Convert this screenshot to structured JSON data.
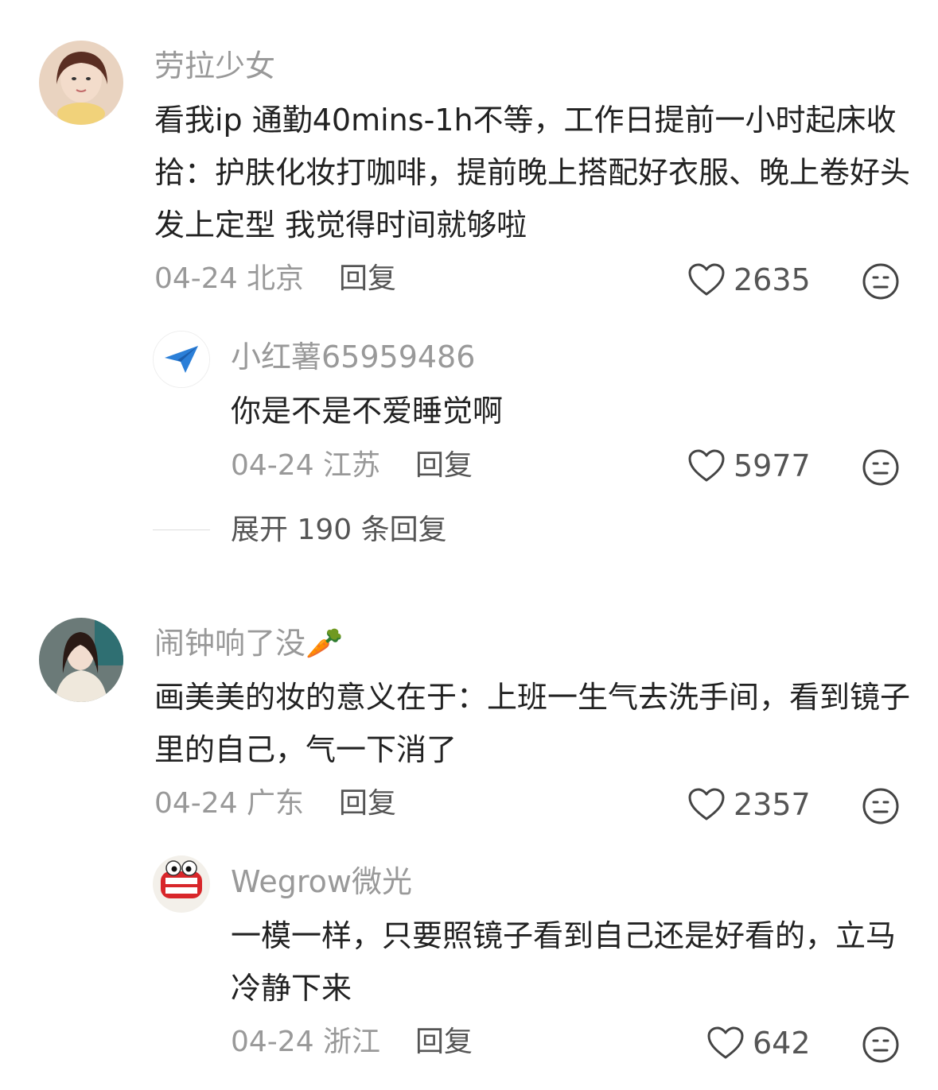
{
  "comments": [
    {
      "user": "劳拉少女",
      "content": "看我ip 通勤40mins-1h不等，工作日提前一小时起床收拾：护肤化妆打咖啡，提前晚上搭配好衣服、晚上卷好头发上定型 我觉得时间就够啦",
      "date_location": "04-24 北京",
      "reply_label": "回复",
      "likes": "2635",
      "replies": [
        {
          "user": "小红薯65959486",
          "content": "你是不是不爱睡觉啊",
          "date_location": "04-24 江苏",
          "reply_label": "回复",
          "likes": "5977"
        }
      ],
      "expand_label": "展开 190 条回复"
    },
    {
      "user": "闹钟响了没🥕",
      "content": "画美美的妆的意义在于：上班一生气去洗手间，看到镜子里的自己，气一下消了",
      "date_location": "04-24 广东",
      "reply_label": "回复",
      "likes": "2357",
      "replies": [
        {
          "user": "Wegrow微光",
          "content": "一模一样，只要照镜子看到自己还是好看的，立马冷静下来",
          "date_location": "04-24 浙江",
          "reply_label": "回复",
          "likes": "642"
        }
      ]
    }
  ],
  "icons": {
    "like": "heart-outline-icon",
    "reaction": "neutral-face-icon",
    "reply_avatar_1": "paper-plane-icon",
    "emoji_inline": "peach-face-emoji"
  },
  "colors": {
    "secondary_text": "#999999",
    "primary_text": "#222222",
    "action_text": "#555555"
  }
}
